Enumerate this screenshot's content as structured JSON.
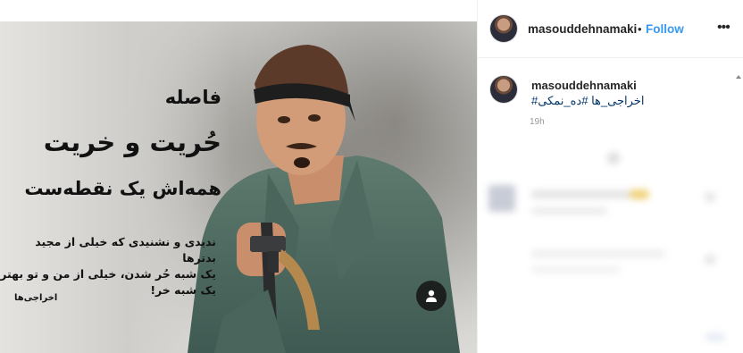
{
  "photo": {
    "headline_1": "فاصله",
    "headline_2": "حُریت و خریت",
    "headline_3": "همه‌اش یک نقطه‌ست",
    "body_lines": [
      "ندیدی و نشنیدی که خیلی از مجید بدترها",
      "یک شبه حُر شدن، خیلی از من و تو بهتر",
      "یک شبه خر!"
    ],
    "tag_text": "اخراجی‌ها"
  },
  "header": {
    "username": "masouddehnamaki",
    "separator": "•",
    "follow_label": "Follow",
    "more_label": "•••"
  },
  "caption": {
    "username": "masouddehnamaki",
    "hashtag_1": "#اخراجی_ها",
    "hashtag_2": "#ده_نمکی",
    "time": "19h"
  },
  "colors": {
    "follow": "#3897f0",
    "hashtag": "#003569",
    "username": "#262626",
    "time": "#999999"
  }
}
